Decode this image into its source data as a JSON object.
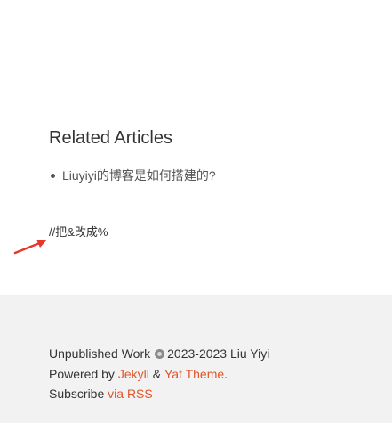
{
  "related": {
    "heading": "Related Articles",
    "items": [
      {
        "label": "Liuyiyi的博客是如何搭建的?"
      }
    ]
  },
  "note": {
    "text": "//把&改成%"
  },
  "footer": {
    "license_text": "Unpublished Work",
    "copyright_text": "2023-2023 Liu Yiyi",
    "powered_prefix": "Powered by",
    "jekyll_label": "Jekyll",
    "amp": "&",
    "theme_label": "Yat Theme",
    "period": ".",
    "subscribe_prefix": "Subscribe",
    "rss_label": "via RSS"
  },
  "colors": {
    "link_accent": "#e0552a",
    "arrow": "#e8362c",
    "footer_bg": "#f2f2f2"
  },
  "icons": {
    "license": "creative-commons-icon",
    "annotation": "red-arrow-icon"
  }
}
